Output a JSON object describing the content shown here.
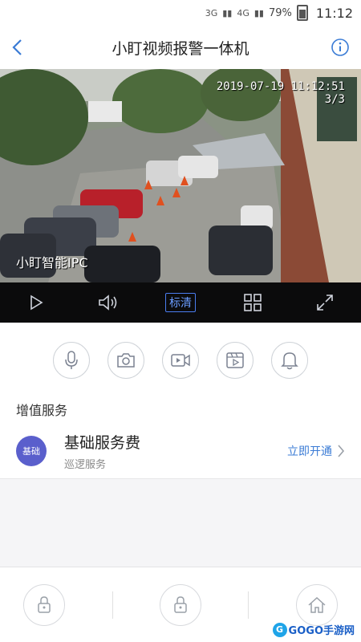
{
  "status_bar": {
    "network_1": "3G",
    "network_2": "4G",
    "battery": "79%",
    "time": "11:12"
  },
  "nav": {
    "title": "小盯视频报警一体机",
    "back_icon": "chevron-left-icon",
    "info_icon": "info-icon"
  },
  "video": {
    "timestamp": "2019-07-19 11:12:51",
    "page_indicator": "3/3",
    "brand_overlay": "小盯智能IPC"
  },
  "controls": {
    "quality_label": "标清",
    "icons": [
      "play-icon",
      "volume-icon",
      "grid-icon",
      "fullscreen-icon"
    ]
  },
  "actions": [
    "microphone-icon",
    "camera-icon",
    "video-record-icon",
    "playback-icon",
    "bell-icon"
  ],
  "value_services": {
    "title": "增值服务",
    "item": {
      "badge": "基础",
      "name": "基础服务费",
      "sub": "巡逻服务",
      "action": "立即开通"
    }
  },
  "watermark": {
    "text": "GOGO手游网"
  },
  "colors": {
    "accent": "#3a7bd5",
    "badge": "#5a5fcc"
  }
}
